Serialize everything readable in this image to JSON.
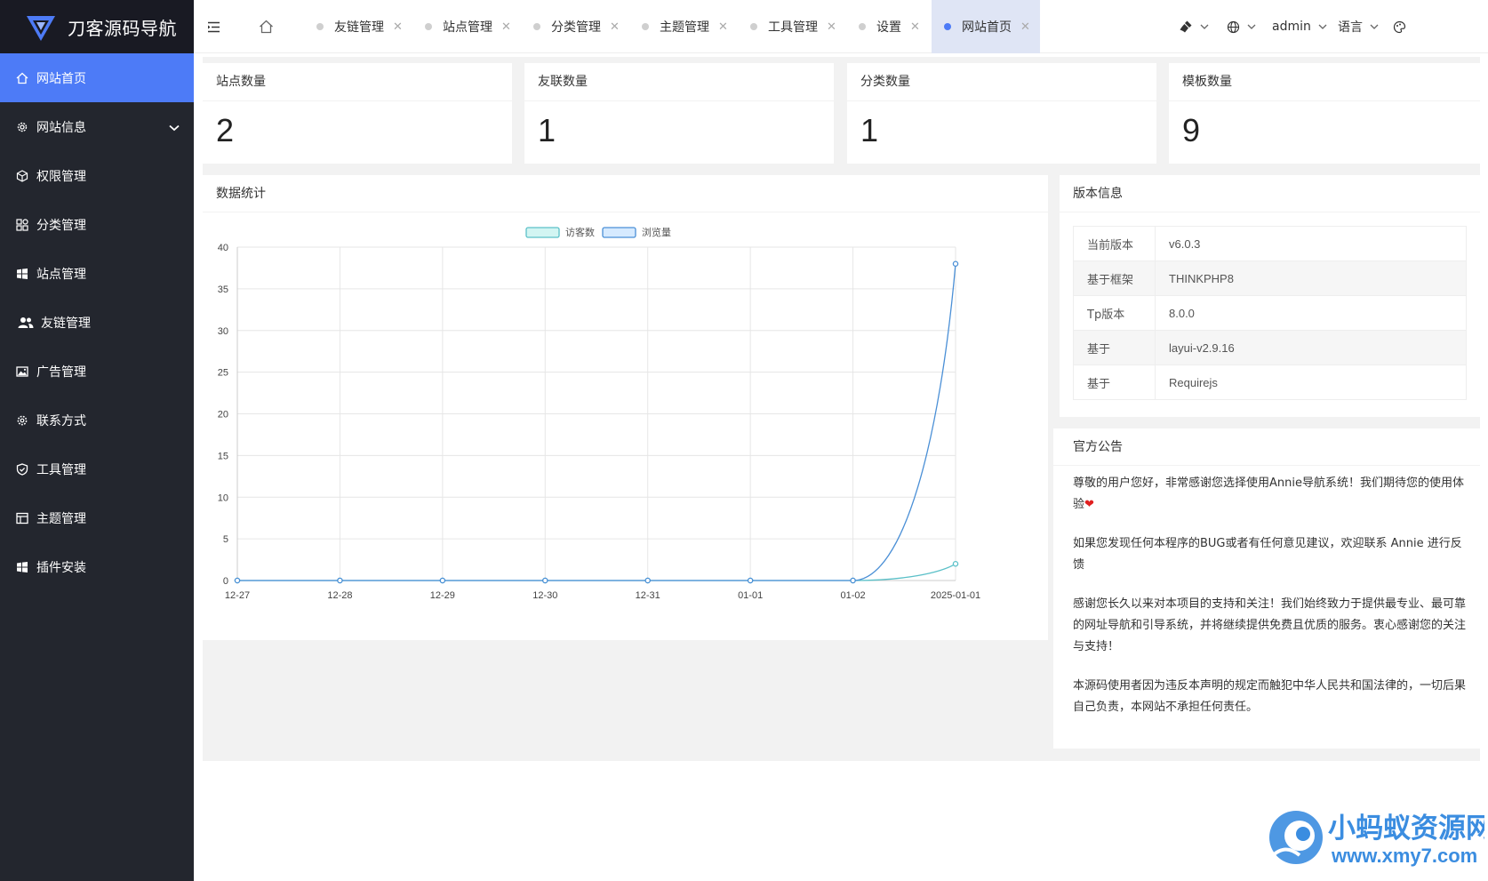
{
  "app": {
    "logo_text": "刀客源码导航"
  },
  "sidebar": {
    "items": [
      {
        "label": "网站首页",
        "icon": "home-icon",
        "active": true
      },
      {
        "label": "网站信息",
        "icon": "gear-icon",
        "expandable": true
      },
      {
        "label": "权限管理",
        "icon": "cube-icon"
      },
      {
        "label": "分类管理",
        "icon": "apps-icon"
      },
      {
        "label": "站点管理",
        "icon": "windows-icon"
      },
      {
        "label": "友链管理",
        "icon": "users-icon"
      },
      {
        "label": "广告管理",
        "icon": "picture-icon"
      },
      {
        "label": "联系方式",
        "icon": "cog-icon"
      },
      {
        "label": "工具管理",
        "icon": "shield-check-icon"
      },
      {
        "label": "主题管理",
        "icon": "table-icon"
      },
      {
        "label": "插件安装",
        "icon": "windows-icon"
      }
    ]
  },
  "header": {
    "tabs": [
      {
        "label": "友链管理"
      },
      {
        "label": "站点管理"
      },
      {
        "label": "分类管理"
      },
      {
        "label": "主题管理"
      },
      {
        "label": "工具管理"
      },
      {
        "label": "设置"
      },
      {
        "label": "网站首页",
        "active": true
      }
    ],
    "user": "admin",
    "language": "语言"
  },
  "stats": [
    {
      "label": "站点数量",
      "value": "2"
    },
    {
      "label": "友联数量",
      "value": "1"
    },
    {
      "label": "分类数量",
      "value": "1"
    },
    {
      "label": "模板数量",
      "value": "9"
    }
  ],
  "chart_panel": {
    "title": "数据统计"
  },
  "chart_data": {
    "type": "line",
    "categories": [
      "12-27",
      "12-28",
      "12-29",
      "12-30",
      "12-31",
      "01-01",
      "01-02",
      "2025-01-01"
    ],
    "series": [
      {
        "name": "访客数",
        "values": [
          0,
          0,
          0,
          0,
          0,
          0,
          0,
          2
        ],
        "color": "#5bc0c8"
      },
      {
        "name": "浏览量",
        "values": [
          0,
          0,
          0,
          0,
          0,
          0,
          0,
          38
        ],
        "color": "#4a8fd6"
      }
    ],
    "yticks": [
      0,
      5,
      10,
      15,
      20,
      25,
      30,
      35,
      40
    ],
    "ylim": [
      0,
      40
    ],
    "grid": true,
    "legend": "top-center"
  },
  "version_panel": {
    "title": "版本信息",
    "rows": [
      {
        "key": "当前版本",
        "value": "v6.0.3"
      },
      {
        "key": "基于框架",
        "value": "THINKPHP8"
      },
      {
        "key": "Tp版本",
        "value": "8.0.0"
      },
      {
        "key": "基于",
        "value": "layui-v2.9.16"
      },
      {
        "key": "基于",
        "value": "Requirejs"
      }
    ]
  },
  "notice_panel": {
    "title": "官方公告",
    "paragraphs": [
      "尊敬的用户您好，非常感谢您选择使用Annie导航系统！我们期待您的使用体验",
      "如果您发现任何本程序的BUG或者有任何意见建议，欢迎联系 Annie 进行反馈",
      "感谢您长久以来对本项目的支持和关注！我们始终致力于提供最专业、最可靠的网址导航和引导系统，并将继续提供免费且优质的服务。衷心感谢您的关注与支持！",
      "本源码使用者因为违反本声明的规定而触犯中华人民共和国法律的，一切后果自己负责，本网站不承担任何责任。"
    ],
    "heart": "❤"
  },
  "watermark": {
    "title": "小蚂蚁资源网",
    "url": "www.xmy7.com"
  }
}
